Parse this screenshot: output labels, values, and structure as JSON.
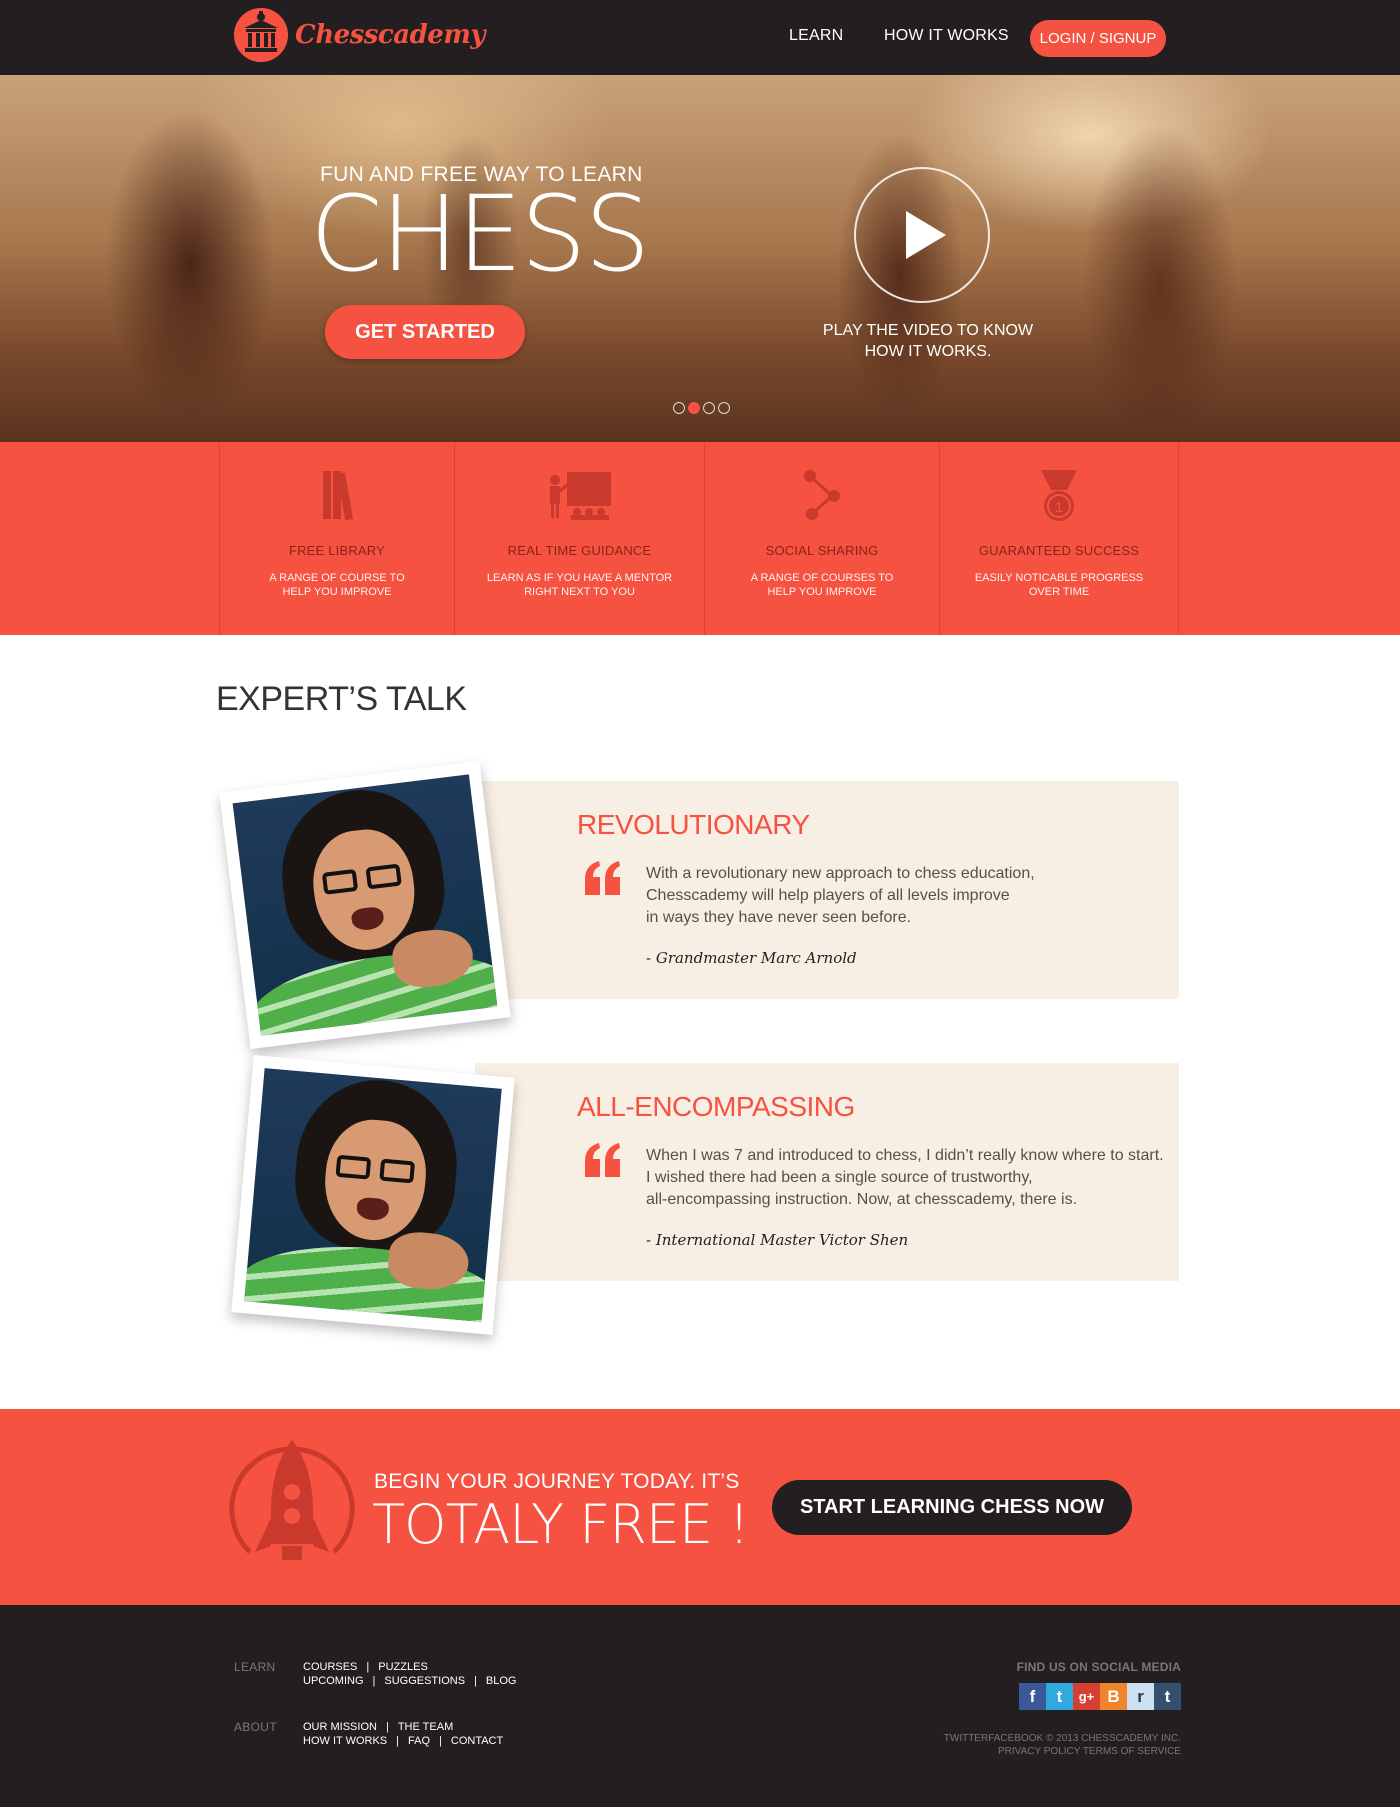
{
  "header": {
    "brand": "Chesscademy",
    "nav": [
      {
        "label": "LEARN"
      },
      {
        "label": "HOW IT WORKS"
      }
    ],
    "login_label": "LOGIN / SIGNUP"
  },
  "hero": {
    "tagline": "FUN AND FREE WAY TO LEARN",
    "title": "CHESS",
    "cta_label": "GET STARTED",
    "video_caption_line1": "PLAY THE VIDEO TO KNOW",
    "video_caption_line2": "HOW IT WORKS.",
    "slides_total": 4,
    "slide_active": 2
  },
  "features": [
    {
      "title": "FREE LIBRARY",
      "desc1": "A RANGE OF COURSE TO",
      "desc2": "HELP YOU IMPROVE",
      "icon": "books-icon"
    },
    {
      "title": "REAL TIME GUIDANCE",
      "desc1": "LEARN AS IF YOU HAVE A MENTOR",
      "desc2": "RIGHT NEXT TO YOU",
      "icon": "teacher-board-icon"
    },
    {
      "title": "SOCIAL SHARING",
      "desc1": "A RANGE OF COURSES TO",
      "desc2": "HELP YOU IMPROVE",
      "icon": "share-icon"
    },
    {
      "title": "GUARANTEED SUCCESS",
      "desc1": "EASILY NOTICABLE PROGRESS",
      "desc2": "OVER TIME",
      "icon": "medal-icon"
    }
  ],
  "experts": {
    "section_title": "EXPERT’S TALK",
    "items": [
      {
        "title": "REVOLUTIONARY",
        "line1": "With a revolutionary new approach to chess education,",
        "line2": "Chesscademy will help players of all levels improve",
        "line3": "in ways they have never seen before.",
        "author": "- Grandmaster Marc Arnold"
      },
      {
        "title": "ALL-ENCOMPASSING",
        "line1": "When I was 7 and introduced to chess, I didn’t really know where to start.",
        "line2": "I wished there had been a single source of trustworthy,",
        "line3": "all-encompassing instruction. Now, at chesscademy, there is.",
        "author": "- International Master Victor Shen"
      }
    ]
  },
  "cta": {
    "sub": "BEGIN YOUR JOURNEY TODAY. IT’S",
    "main": "TOTALY FREE !",
    "button_label": "START LEARNING CHESS NOW"
  },
  "footer": {
    "learn_label": "LEARN",
    "learn_row1": [
      "COURSES",
      "PUZZLES"
    ],
    "learn_row2": [
      "UPCOMING",
      "SUGGESTIONS",
      "BLOG"
    ],
    "about_label": "ABOUT",
    "about_row1": [
      "OUR MISSION",
      "THE TEAM"
    ],
    "about_row2": [
      "HOW IT WORKS",
      "FAQ",
      "CONTACT"
    ],
    "social_title": "FIND US ON SOCIAL MEDIA",
    "social": [
      {
        "icon": "facebook-icon",
        "glyph": "f",
        "color": "#3b5998"
      },
      {
        "icon": "twitter-icon",
        "glyph": "t",
        "color": "#2fa9e0"
      },
      {
        "icon": "google-plus-icon",
        "glyph": "g+",
        "color": "#d44132"
      },
      {
        "icon": "blogger-icon",
        "glyph": "B",
        "color": "#f0842c"
      },
      {
        "icon": "reddit-icon",
        "glyph": "r",
        "color": "#cde1f3"
      },
      {
        "icon": "tumblr-icon",
        "glyph": "t",
        "color": "#35506f"
      }
    ],
    "copyright_prefix": "TWITTERFACEBOOK © 2013 CHESSCADEMY INC.",
    "privacy_label": "PRIVACY POLICY",
    "terms_label": "TERMS OF SERVICE"
  },
  "colors": {
    "accent": "#f55242",
    "dark": "#231f20",
    "card_bg": "#f7efe3"
  }
}
